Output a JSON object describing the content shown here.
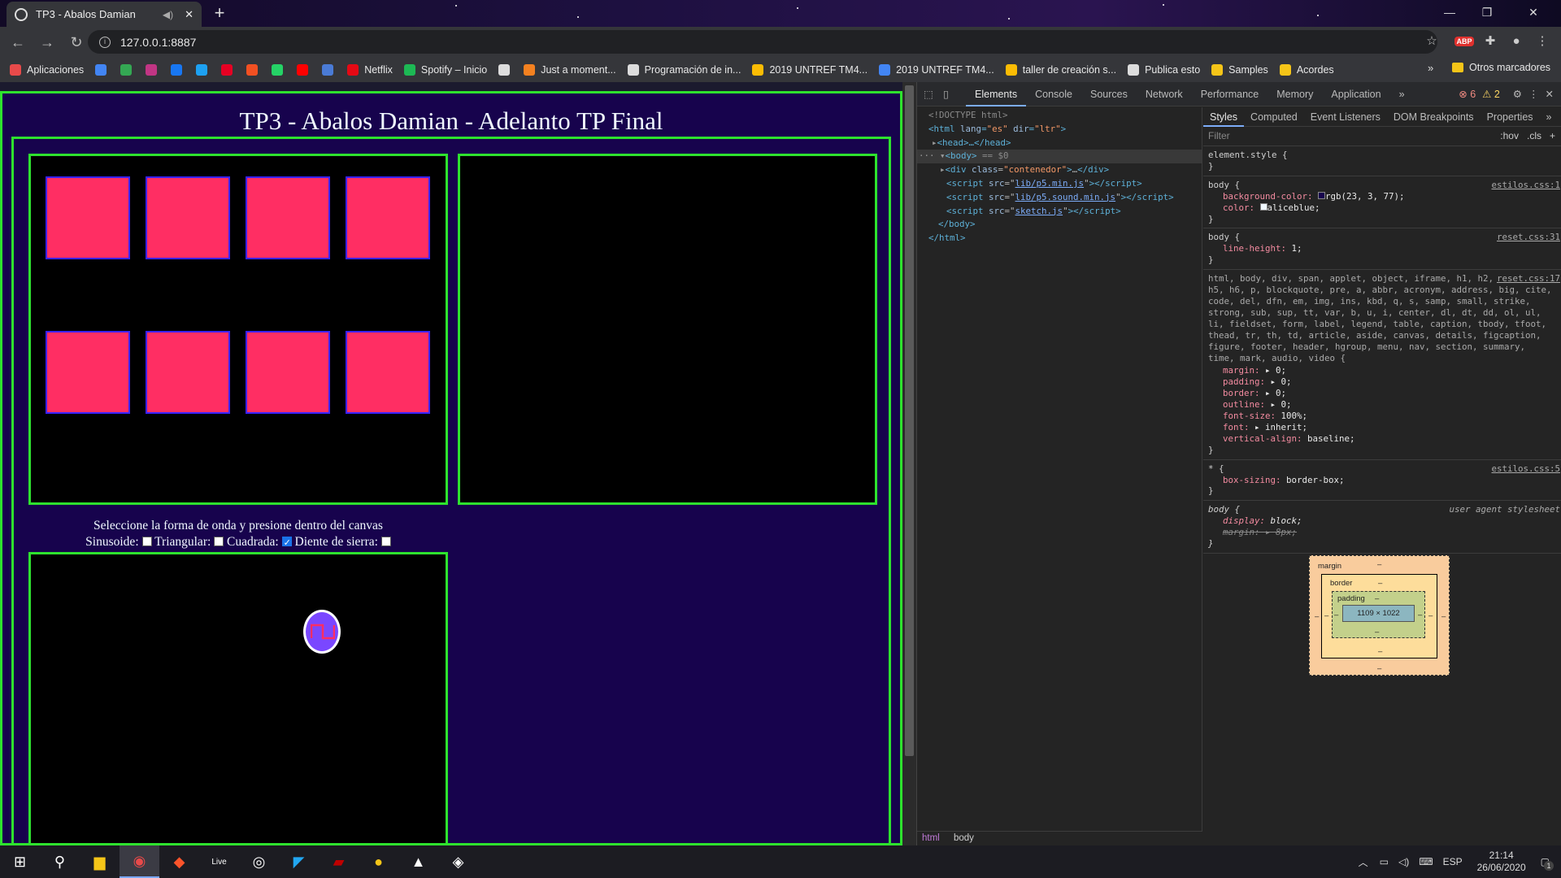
{
  "browser": {
    "tab_title": "TP3 - Abalos Damian",
    "new_tab": "+",
    "url": "127.0.0.1:8887",
    "window": {
      "minimize": "—",
      "restore": "❐",
      "close": "✕"
    },
    "bookmarks": [
      {
        "label": "Aplicaciones",
        "color": "#e84a4a"
      },
      {
        "label": "",
        "color": "#4285f4"
      },
      {
        "label": "",
        "color": "#34a853"
      },
      {
        "label": "",
        "color": "#c13584"
      },
      {
        "label": "",
        "color": "#1877f2"
      },
      {
        "label": "",
        "color": "#1da1f2"
      },
      {
        "label": "",
        "color": "#e60023"
      },
      {
        "label": "",
        "color": "#f25022"
      },
      {
        "label": "",
        "color": "#25d366"
      },
      {
        "label": "",
        "color": "#ff0000"
      },
      {
        "label": "",
        "color": "#4a7bd6"
      },
      {
        "label": "Netflix",
        "color": "#e50914"
      },
      {
        "label": "Spotify – Inicio",
        "color": "#1db954"
      },
      {
        "label": "",
        "color": "#dddddd"
      },
      {
        "label": "Just a moment...",
        "color": "#f48120"
      },
      {
        "label": "Programación de in...",
        "color": "#dddddd"
      },
      {
        "label": "2019 UNTREF TM4...",
        "color": "#fbbc04"
      },
      {
        "label": "2019 UNTREF TM4...",
        "color": "#4285f4"
      },
      {
        "label": "taller de creación s...",
        "color": "#fbbc04"
      },
      {
        "label": "Publica esto",
        "color": "#dddddd"
      },
      {
        "label": "Samples",
        "color": "#f5c518"
      },
      {
        "label": "Acordes",
        "color": "#f5c518"
      }
    ],
    "bookmarks_more": "»",
    "other_bookmarks": "Otros marcadores"
  },
  "page": {
    "title": "TP3 - Abalos Damian - Adelanto TP Final",
    "instruction": "Seleccione la forma de onda y presione dentro del canvas",
    "options": [
      {
        "label": "Sinusoide:",
        "checked": false
      },
      {
        "label": "Triangular:",
        "checked": false
      },
      {
        "label": "Cuadrada:",
        "checked": true
      },
      {
        "label": "Diente de sierra:",
        "checked": false
      }
    ],
    "pad_color": "#ff2e63",
    "border_color": "#2ee22e",
    "background_color": "#17034d"
  },
  "devtools": {
    "tabs": [
      "Elements",
      "Console",
      "Sources",
      "Network",
      "Performance",
      "Memory",
      "Application",
      "»"
    ],
    "errors": "6",
    "warnings": "2",
    "dom": {
      "doctype": "<!DOCTYPE html>",
      "html_open": "html",
      "lang_attr": "lang",
      "lang_val": "\"es\"",
      "dir_attr": "dir",
      "dir_val": "\"ltr\"",
      "head": "<head>…</head>",
      "body": "<body>",
      "body_sel": "== $0",
      "div_class": "\"contenedor\"",
      "script1": "lib/p5.min.js",
      "script2": "lib/p5.sound.min.js",
      "script3": "sketch.js",
      "body_close": "</body>",
      "html_close": "</html>"
    },
    "crumbs": [
      "html",
      "body"
    ],
    "style_tabs": [
      "Styles",
      "Computed",
      "Event Listeners",
      "DOM Breakpoints",
      "Properties",
      "»"
    ],
    "filter_placeholder": "Filter",
    "hov": ":hov",
    "cls": ".cls",
    "plus": "+",
    "rules": {
      "element_style": "element.style {",
      "body1_sel": "body {",
      "body1_src": "estilos.css:1",
      "bg_prop": "background-color",
      "bg_val": "rgb(23, 3, 77);",
      "color_prop": "color",
      "color_val": "aliceblue;",
      "body2_src": "reset.css:31",
      "lh_prop": "line-height",
      "lh_val": "1;",
      "reset_src": "reset.css:17",
      "reset_sel": "html, body, div, span, applet, object, iframe, h1, h2, h3, h4, h5, h6, p, blockquote, pre, a, abbr, acronym, address, big, cite, code, del, dfn, em, img, ins, kbd, q, s, samp, small, strike, strong, sub, sup, tt, var, b, u, i, center, dl, dt, dd, ol, ul, li, fieldset, form, label, legend, table, caption, tbody, tfoot, thead, tr, th, td, article, aside, canvas, details, figcaption, figure, footer, header, hgroup, menu, nav, section, summary, time, mark, audio, video {",
      "reset_props": [
        {
          "p": "margin",
          "v": "▸ 0;"
        },
        {
          "p": "padding",
          "v": "▸ 0;"
        },
        {
          "p": "border",
          "v": "▸ 0;"
        },
        {
          "p": "outline",
          "v": "▸ 0;"
        },
        {
          "p": "font-size",
          "v": "100%;"
        },
        {
          "p": "font",
          "v": "▸ inherit;"
        },
        {
          "p": "vertical-align",
          "v": "baseline;"
        }
      ],
      "star_sel": "* {",
      "star_src": "estilos.css:5",
      "bs_prop": "box-sizing",
      "bs_val": "border-box;",
      "ua_sel": "body {",
      "ua_src": "user agent stylesheet",
      "disp_prop": "display",
      "disp_val": "block;",
      "ua_margin": "margin: ▸ 8px;"
    },
    "box_model": {
      "margin": "margin",
      "border": "border",
      "padding": "padding",
      "dash": "–",
      "content": "1109 × 1022"
    }
  },
  "taskbar": {
    "lang": "ESP",
    "time": "21:14",
    "date": "26/06/2020",
    "notifications": "1"
  }
}
